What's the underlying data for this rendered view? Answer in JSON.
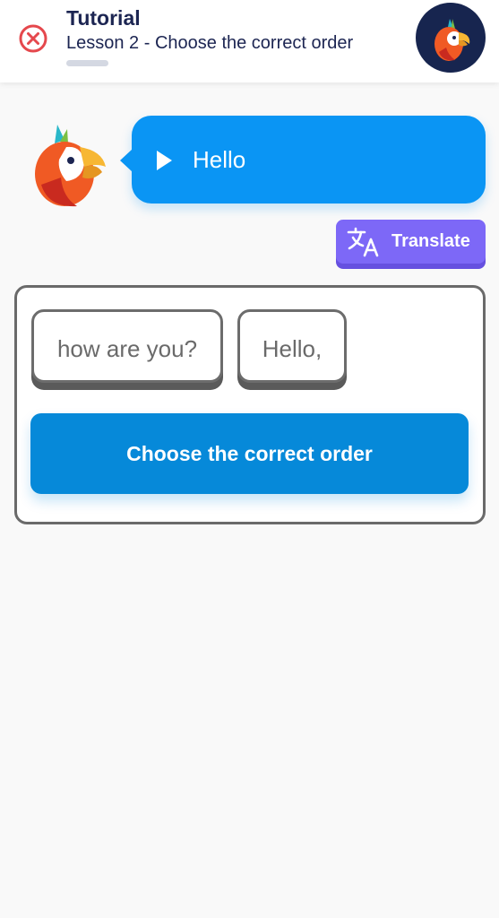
{
  "header": {
    "title": "Tutorial",
    "subtitle": "Lesson 2 - Choose the correct order",
    "progress": 0,
    "close_icon": "close-circle-icon",
    "avatar_icon": "parrot-avatar-icon"
  },
  "bubble": {
    "text": "Hello",
    "play_icon": "play-icon"
  },
  "translate": {
    "label": "Translate",
    "icon": "translate-icon"
  },
  "exercise": {
    "words": [
      "how are you?",
      "Hello,"
    ],
    "button_label": "Choose the correct order"
  },
  "colors": {
    "accent": "#0a95f4",
    "button": "#0689d9",
    "translate": "#7d68f7",
    "close": "#e5484d",
    "title": "#1c2552"
  }
}
